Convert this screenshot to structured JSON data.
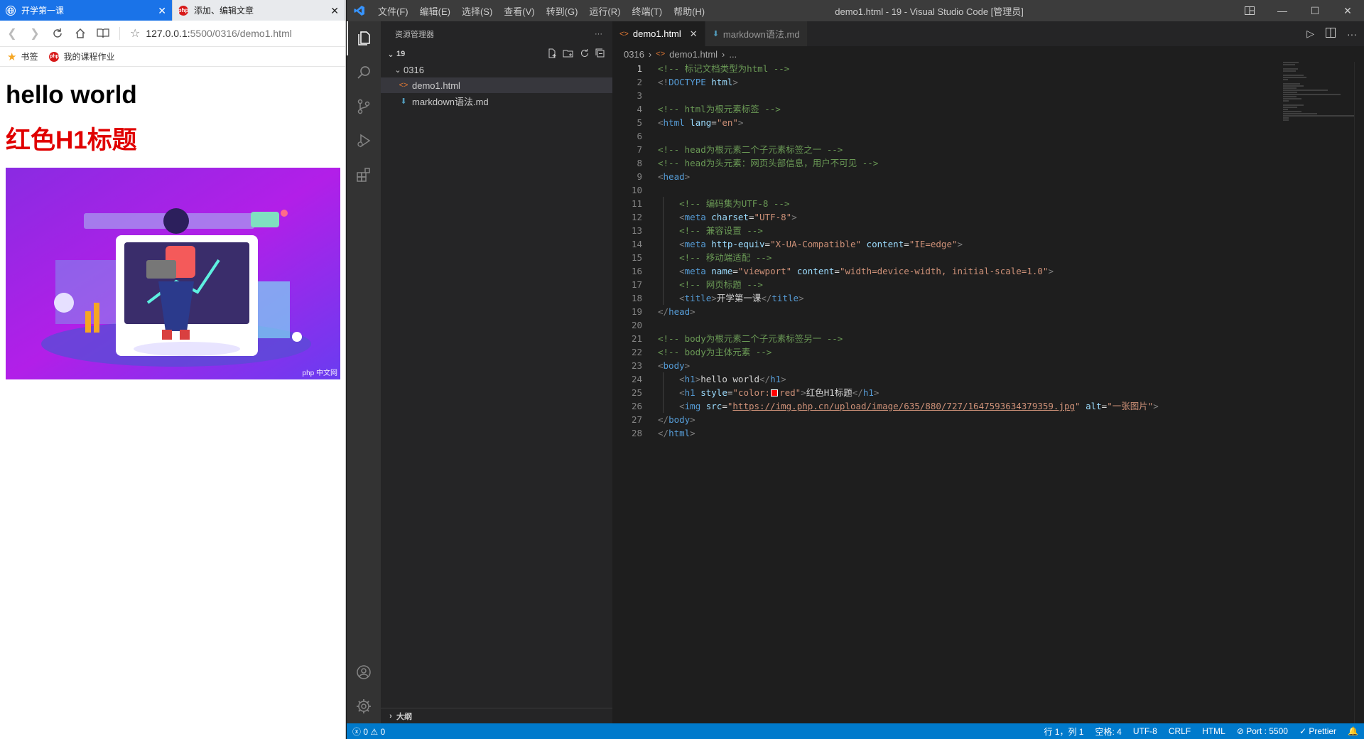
{
  "browser": {
    "tabs": [
      {
        "title": "开学第一课",
        "active": true
      },
      {
        "title": "添加、编辑文章",
        "active": false
      }
    ],
    "address": {
      "host": "127.0.0.1:",
      "path": "5500/0316/demo1.html"
    },
    "bookmarks": [
      {
        "label": "书签",
        "icon": "star-icon"
      },
      {
        "label": "我的课程作业",
        "icon": "php-icon"
      }
    ],
    "content": {
      "heading1": "hello world",
      "heading2": "红色H1标题",
      "image_watermark": "php 中文网"
    }
  },
  "vscode": {
    "menu": [
      "文件(F)",
      "编辑(E)",
      "选择(S)",
      "查看(V)",
      "转到(G)",
      "运行(R)",
      "终端(T)",
      "帮助(H)"
    ],
    "window_title": "demo1.html - 19 - Visual Studio Code [管理员]",
    "explorer": {
      "header": "资源管理器",
      "more": "···",
      "root": "19",
      "folder": "0316",
      "files": [
        {
          "name": "demo1.html",
          "type": "html",
          "selected": true
        },
        {
          "name": "markdown语法.md",
          "type": "md",
          "selected": false
        }
      ],
      "outline": "大纲"
    },
    "tabs": [
      {
        "label": "demo1.html",
        "type": "html",
        "active": true
      },
      {
        "label": "markdown语法.md",
        "type": "md",
        "active": false
      }
    ],
    "breadcrumb": {
      "folder": "0316",
      "file": "demo1.html",
      "more": "..."
    },
    "current_line": 1,
    "code_lines": [
      [
        [
          "com",
          "<!-- 标记文档类型为html -->"
        ]
      ],
      [
        [
          "brk",
          "<!"
        ],
        [
          "tag",
          "DOCTYPE "
        ],
        [
          "attr",
          "html"
        ],
        [
          "brk",
          ">"
        ]
      ],
      [],
      [
        [
          "com",
          "<!-- html为根元素标签 -->"
        ]
      ],
      [
        [
          "brk",
          "<"
        ],
        [
          "tag",
          "html "
        ],
        [
          "attr",
          "lang"
        ],
        [
          "txt",
          "="
        ],
        [
          "str",
          "\"en\""
        ],
        [
          "brk",
          ">"
        ]
      ],
      [],
      [
        [
          "com",
          "<!-- head为根元素二个子元素标签之一 -->"
        ]
      ],
      [
        [
          "com",
          "<!-- head为头元素：网页头部信息，用户不可见 -->"
        ]
      ],
      [
        [
          "brk",
          "<"
        ],
        [
          "tag",
          "head"
        ],
        [
          "brk",
          ">"
        ]
      ],
      [],
      [
        [
          "txt",
          "    "
        ],
        [
          "com",
          "<!-- 编码集为UTF-8 -->"
        ]
      ],
      [
        [
          "txt",
          "    "
        ],
        [
          "brk",
          "<"
        ],
        [
          "tag",
          "meta "
        ],
        [
          "attr",
          "charset"
        ],
        [
          "txt",
          "="
        ],
        [
          "str",
          "\"UTF-8\""
        ],
        [
          "brk",
          ">"
        ]
      ],
      [
        [
          "txt",
          "    "
        ],
        [
          "com",
          "<!-- 兼容设置 -->"
        ]
      ],
      [
        [
          "txt",
          "    "
        ],
        [
          "brk",
          "<"
        ],
        [
          "tag",
          "meta "
        ],
        [
          "attr",
          "http-equiv"
        ],
        [
          "txt",
          "="
        ],
        [
          "str",
          "\"X-UA-Compatible\""
        ],
        [
          "txt",
          " "
        ],
        [
          "attr",
          "content"
        ],
        [
          "txt",
          "="
        ],
        [
          "str",
          "\"IE=edge\""
        ],
        [
          "brk",
          ">"
        ]
      ],
      [
        [
          "txt",
          "    "
        ],
        [
          "com",
          "<!-- 移动端适配 -->"
        ]
      ],
      [
        [
          "txt",
          "    "
        ],
        [
          "brk",
          "<"
        ],
        [
          "tag",
          "meta "
        ],
        [
          "attr",
          "name"
        ],
        [
          "txt",
          "="
        ],
        [
          "str",
          "\"viewport\""
        ],
        [
          "txt",
          " "
        ],
        [
          "attr",
          "content"
        ],
        [
          "txt",
          "="
        ],
        [
          "str",
          "\"width=device-width, initial-scale=1.0\""
        ],
        [
          "brk",
          ">"
        ]
      ],
      [
        [
          "txt",
          "    "
        ],
        [
          "com",
          "<!-- 网页标题 -->"
        ]
      ],
      [
        [
          "txt",
          "    "
        ],
        [
          "brk",
          "<"
        ],
        [
          "tag",
          "title"
        ],
        [
          "brk",
          ">"
        ],
        [
          "txt",
          "开学第一课"
        ],
        [
          "brk",
          "</"
        ],
        [
          "tag",
          "title"
        ],
        [
          "brk",
          ">"
        ]
      ],
      [
        [
          "brk",
          "</"
        ],
        [
          "tag",
          "head"
        ],
        [
          "brk",
          ">"
        ]
      ],
      [],
      [
        [
          "com",
          "<!-- body为根元素二个子元素标签另一 -->"
        ]
      ],
      [
        [
          "com",
          "<!-- body为主体元素 -->"
        ]
      ],
      [
        [
          "brk",
          "<"
        ],
        [
          "tag",
          "body"
        ],
        [
          "brk",
          ">"
        ]
      ],
      [
        [
          "txt",
          "    "
        ],
        [
          "brk",
          "<"
        ],
        [
          "tag",
          "h1"
        ],
        [
          "brk",
          ">"
        ],
        [
          "txt",
          "hello world"
        ],
        [
          "brk",
          "</"
        ],
        [
          "tag",
          "h1"
        ],
        [
          "brk",
          ">"
        ]
      ],
      [
        [
          "txt",
          "    "
        ],
        [
          "brk",
          "<"
        ],
        [
          "tag",
          "h1 "
        ],
        [
          "attr",
          "style"
        ],
        [
          "txt",
          "="
        ],
        [
          "str",
          "\"color:"
        ],
        [
          "swatch",
          "#ff0000"
        ],
        [
          "str",
          "red\""
        ],
        [
          "brk",
          ">"
        ],
        [
          "txt",
          "红色H1标题"
        ],
        [
          "brk",
          "</"
        ],
        [
          "tag",
          "h1"
        ],
        [
          "brk",
          ">"
        ]
      ],
      [
        [
          "txt",
          "    "
        ],
        [
          "brk",
          "<"
        ],
        [
          "tag",
          "img "
        ],
        [
          "attr",
          "src"
        ],
        [
          "txt",
          "="
        ],
        [
          "str",
          "\""
        ],
        [
          "url",
          "https://img.php.cn/upload/image/635/880/727/1647593634379359.jpg"
        ],
        [
          "str",
          "\""
        ],
        [
          "txt",
          " "
        ],
        [
          "attr",
          "alt"
        ],
        [
          "txt",
          "="
        ],
        [
          "str",
          "\"一张图片\""
        ],
        [
          "brk",
          ">"
        ]
      ],
      [
        [
          "brk",
          "</"
        ],
        [
          "tag",
          "body"
        ],
        [
          "brk",
          ">"
        ]
      ],
      [
        [
          "brk",
          "</"
        ],
        [
          "tag",
          "html"
        ],
        [
          "brk",
          ">"
        ]
      ]
    ],
    "status": {
      "errors": "0",
      "warnings": "0",
      "position": "行 1，列 1",
      "spaces": "空格: 4",
      "encoding": "UTF-8",
      "eol": "CRLF",
      "language": "HTML",
      "port": "Port : 5500",
      "prettier": "Prettier"
    },
    "colors": {
      "statusbar": "#007acc",
      "titlebar": "#3c3c3c",
      "accent": "#3794ff"
    }
  }
}
